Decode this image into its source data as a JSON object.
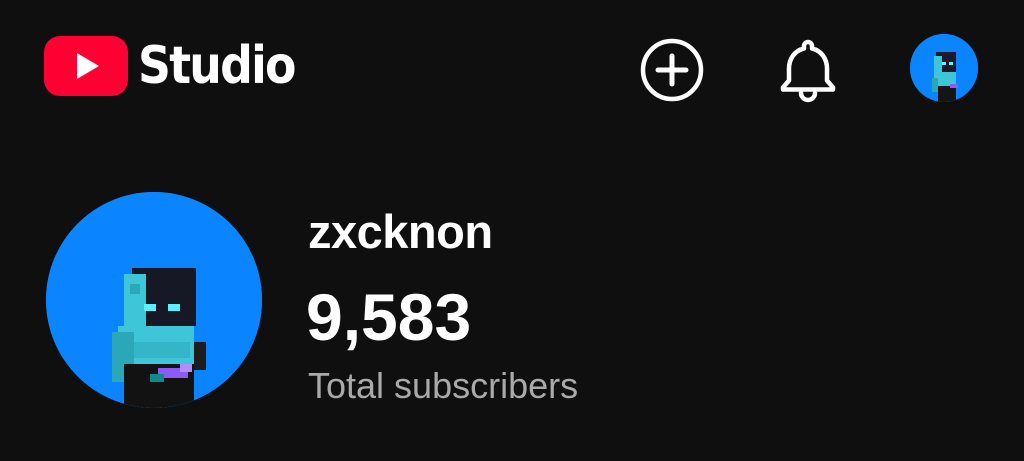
{
  "header": {
    "logo_text": "Studio",
    "brand_color": "#ff0033",
    "icons": {
      "create": "create-plus-icon",
      "notifications": "bell-icon",
      "account": "account-avatar"
    }
  },
  "channel": {
    "name": "zxcknon",
    "subscriber_count": "9,583",
    "subscriber_label": "Total subscribers",
    "avatar_bg_color": "#0a84ff"
  }
}
